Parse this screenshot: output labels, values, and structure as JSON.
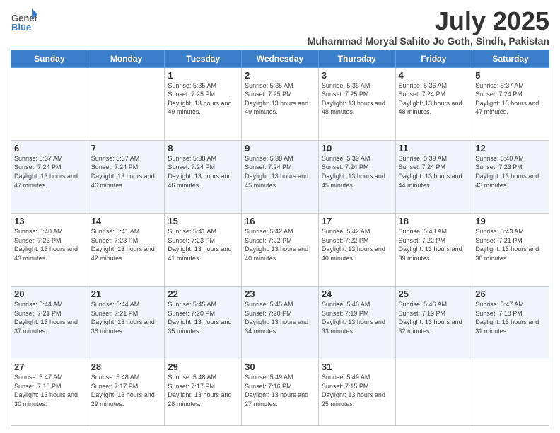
{
  "header": {
    "logo_line1": "General",
    "logo_line2": "Blue",
    "main_title": "July 2025",
    "subtitle": "Muhammad Moryal Sahito Jo Goth, Sindh, Pakistan"
  },
  "days_of_week": [
    "Sunday",
    "Monday",
    "Tuesday",
    "Wednesday",
    "Thursday",
    "Friday",
    "Saturday"
  ],
  "weeks": [
    [
      {
        "day": "",
        "empty": true
      },
      {
        "day": "",
        "empty": true
      },
      {
        "day": "1",
        "sunrise": "5:35 AM",
        "sunset": "7:25 PM",
        "daylight": "13 hours and 49 minutes."
      },
      {
        "day": "2",
        "sunrise": "5:35 AM",
        "sunset": "7:25 PM",
        "daylight": "13 hours and 49 minutes."
      },
      {
        "day": "3",
        "sunrise": "5:36 AM",
        "sunset": "7:25 PM",
        "daylight": "13 hours and 48 minutes."
      },
      {
        "day": "4",
        "sunrise": "5:36 AM",
        "sunset": "7:24 PM",
        "daylight": "13 hours and 48 minutes."
      },
      {
        "day": "5",
        "sunrise": "5:37 AM",
        "sunset": "7:24 PM",
        "daylight": "13 hours and 47 minutes."
      }
    ],
    [
      {
        "day": "6",
        "sunrise": "5:37 AM",
        "sunset": "7:24 PM",
        "daylight": "13 hours and 47 minutes."
      },
      {
        "day": "7",
        "sunrise": "5:37 AM",
        "sunset": "7:24 PM",
        "daylight": "13 hours and 46 minutes."
      },
      {
        "day": "8",
        "sunrise": "5:38 AM",
        "sunset": "7:24 PM",
        "daylight": "13 hours and 46 minutes."
      },
      {
        "day": "9",
        "sunrise": "5:38 AM",
        "sunset": "7:24 PM",
        "daylight": "13 hours and 45 minutes."
      },
      {
        "day": "10",
        "sunrise": "5:39 AM",
        "sunset": "7:24 PM",
        "daylight": "13 hours and 45 minutes."
      },
      {
        "day": "11",
        "sunrise": "5:39 AM",
        "sunset": "7:24 PM",
        "daylight": "13 hours and 44 minutes."
      },
      {
        "day": "12",
        "sunrise": "5:40 AM",
        "sunset": "7:23 PM",
        "daylight": "13 hours and 43 minutes."
      }
    ],
    [
      {
        "day": "13",
        "sunrise": "5:40 AM",
        "sunset": "7:23 PM",
        "daylight": "13 hours and 43 minutes."
      },
      {
        "day": "14",
        "sunrise": "5:41 AM",
        "sunset": "7:23 PM",
        "daylight": "13 hours and 42 minutes."
      },
      {
        "day": "15",
        "sunrise": "5:41 AM",
        "sunset": "7:23 PM",
        "daylight": "13 hours and 41 minutes."
      },
      {
        "day": "16",
        "sunrise": "5:42 AM",
        "sunset": "7:22 PM",
        "daylight": "13 hours and 40 minutes."
      },
      {
        "day": "17",
        "sunrise": "5:42 AM",
        "sunset": "7:22 PM",
        "daylight": "13 hours and 40 minutes."
      },
      {
        "day": "18",
        "sunrise": "5:43 AM",
        "sunset": "7:22 PM",
        "daylight": "13 hours and 39 minutes."
      },
      {
        "day": "19",
        "sunrise": "5:43 AM",
        "sunset": "7:21 PM",
        "daylight": "13 hours and 38 minutes."
      }
    ],
    [
      {
        "day": "20",
        "sunrise": "5:44 AM",
        "sunset": "7:21 PM",
        "daylight": "13 hours and 37 minutes."
      },
      {
        "day": "21",
        "sunrise": "5:44 AM",
        "sunset": "7:21 PM",
        "daylight": "13 hours and 36 minutes."
      },
      {
        "day": "22",
        "sunrise": "5:45 AM",
        "sunset": "7:20 PM",
        "daylight": "13 hours and 35 minutes."
      },
      {
        "day": "23",
        "sunrise": "5:45 AM",
        "sunset": "7:20 PM",
        "daylight": "13 hours and 34 minutes."
      },
      {
        "day": "24",
        "sunrise": "5:46 AM",
        "sunset": "7:19 PM",
        "daylight": "13 hours and 33 minutes."
      },
      {
        "day": "25",
        "sunrise": "5:46 AM",
        "sunset": "7:19 PM",
        "daylight": "13 hours and 32 minutes."
      },
      {
        "day": "26",
        "sunrise": "5:47 AM",
        "sunset": "7:18 PM",
        "daylight": "13 hours and 31 minutes."
      }
    ],
    [
      {
        "day": "27",
        "sunrise": "5:47 AM",
        "sunset": "7:18 PM",
        "daylight": "13 hours and 30 minutes."
      },
      {
        "day": "28",
        "sunrise": "5:48 AM",
        "sunset": "7:17 PM",
        "daylight": "13 hours and 29 minutes."
      },
      {
        "day": "29",
        "sunrise": "5:48 AM",
        "sunset": "7:17 PM",
        "daylight": "13 hours and 28 minutes."
      },
      {
        "day": "30",
        "sunrise": "5:49 AM",
        "sunset": "7:16 PM",
        "daylight": "13 hours and 27 minutes."
      },
      {
        "day": "31",
        "sunrise": "5:49 AM",
        "sunset": "7:15 PM",
        "daylight": "13 hours and 25 minutes."
      },
      {
        "day": "",
        "empty": true
      },
      {
        "day": "",
        "empty": true
      }
    ]
  ]
}
